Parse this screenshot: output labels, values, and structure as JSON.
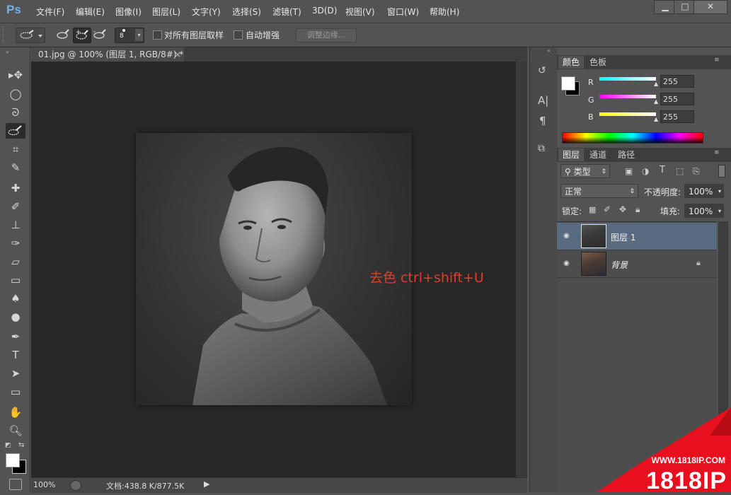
{
  "app": {
    "logo": "Ps"
  },
  "menu": [
    "文件(F)",
    "编辑(E)",
    "图像(I)",
    "图层(L)",
    "文字(Y)",
    "选择(S)",
    "滤镜(T)",
    "3D(D)",
    "视图(V)",
    "窗口(W)",
    "帮助(H)"
  ],
  "window_controls": {
    "minimize": "▁",
    "maximize": "□",
    "close": "✕"
  },
  "options": {
    "brush_size": "8",
    "sample_all_layers": "对所有图层取样",
    "auto_enhance": "自动增强",
    "refine_edge": "调整边缘..."
  },
  "document": {
    "tab_title": "01.jpg @ 100% (图层 1, RGB/8#) *",
    "tab_close": "×",
    "annotation": "去色 ctrl+shift+U"
  },
  "status": {
    "zoom": "100%",
    "doc_info": "文档:438.8 K/877.5K"
  },
  "color_panel": {
    "tabs": [
      "颜色",
      "色板"
    ],
    "channels": [
      {
        "label": "R",
        "value": "255"
      },
      {
        "label": "G",
        "value": "255"
      },
      {
        "label": "B",
        "value": "255"
      }
    ]
  },
  "layers_panel": {
    "tabs": [
      "图层",
      "通道",
      "路径"
    ],
    "filter_kind": "类型",
    "blend_mode": "正常",
    "opacity_label": "不透明度:",
    "opacity": "100%",
    "lock_label": "锁定:",
    "fill_label": "填充:",
    "fill": "100%",
    "layers": [
      {
        "name": "图层 1",
        "selected": true
      },
      {
        "name": "背景",
        "selected": false,
        "locked": true
      }
    ]
  },
  "watermark": {
    "url": "WWW.1818IP.COM",
    "brand": "1818IP"
  },
  "colors": {
    "accent_red": "#e63a2a",
    "ps_blue": "#76b1e8",
    "selected_layer": "#5a6b80"
  }
}
